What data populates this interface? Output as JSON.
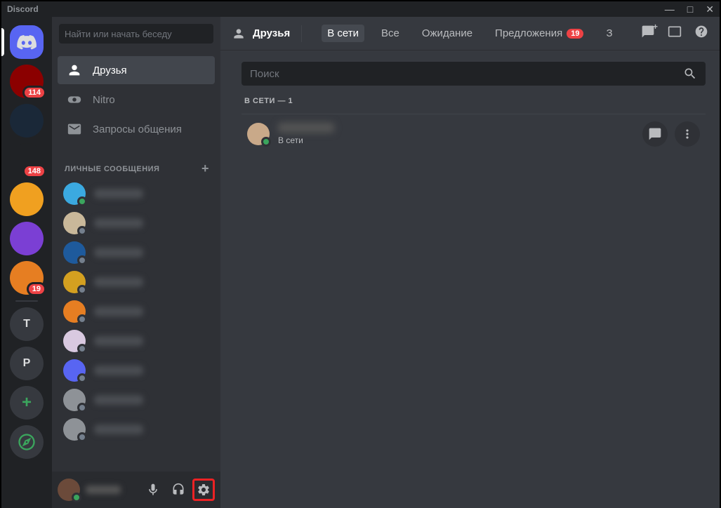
{
  "window": {
    "title": "Discord"
  },
  "servers": [
    {
      "type": "home",
      "active": true
    },
    {
      "type": "img",
      "bg": "#8b0000",
      "text": "",
      "badge": "114"
    },
    {
      "type": "img",
      "bg": "#1a2838",
      "text": ""
    },
    {
      "type": "img",
      "bg": "#202225",
      "text": "",
      "badge": "148"
    },
    {
      "type": "img",
      "bg": "#f0a020",
      "text": ""
    },
    {
      "type": "img",
      "bg": "#7b3fd4",
      "text": ""
    },
    {
      "type": "img",
      "bg": "#e67e22",
      "text": "",
      "badge": "19"
    },
    {
      "type": "sep"
    },
    {
      "type": "letter",
      "bg": "#36393f",
      "text": "T"
    },
    {
      "type": "letter",
      "bg": "#36393f",
      "text": "P"
    },
    {
      "type": "add"
    },
    {
      "type": "compass"
    }
  ],
  "sidebar": {
    "search_placeholder": "Найти или начать беседу",
    "nav": [
      {
        "icon": "friends",
        "label": "Друзья",
        "active": true
      },
      {
        "icon": "nitro",
        "label": "Nitro"
      },
      {
        "icon": "mail",
        "label": "Запросы общения"
      }
    ],
    "dm_header": "ЛИЧНЫЕ СООБЩЕНИЯ",
    "dms": [
      {
        "name": "██████",
        "status": "online",
        "bg": "#3ba9e0"
      },
      {
        "name": "██████",
        "status": "offline",
        "bg": "#c9b89a"
      },
      {
        "name": "██████",
        "status": "offline",
        "bg": "#1e5a9c"
      },
      {
        "name": "██████",
        "status": "offline",
        "bg": "#d4a020"
      },
      {
        "name": "██████",
        "status": "offline",
        "bg": "#e67e22"
      },
      {
        "name": "██████",
        "status": "offline",
        "bg": "#d9c9e0"
      },
      {
        "name": "██████",
        "status": "offline",
        "bg": "#5865f2"
      },
      {
        "name": "██████",
        "status": "offline",
        "bg": "#8e9297"
      },
      {
        "name": "██████",
        "status": "offline",
        "bg": "#8e9297"
      }
    ],
    "user": {
      "name": "█████",
      "status": "online"
    }
  },
  "header": {
    "title": "Друзья",
    "tabs": [
      {
        "label": "В сети",
        "active": true
      },
      {
        "label": "Все"
      },
      {
        "label": "Ожидание"
      },
      {
        "label": "Предложения",
        "badge": "19"
      },
      {
        "label": "З"
      }
    ]
  },
  "content": {
    "search_placeholder": "Поиск",
    "section_title": "В СЕТИ — 1",
    "friends": [
      {
        "name": "██████",
        "status_text": "В сети",
        "status": "online"
      }
    ]
  }
}
